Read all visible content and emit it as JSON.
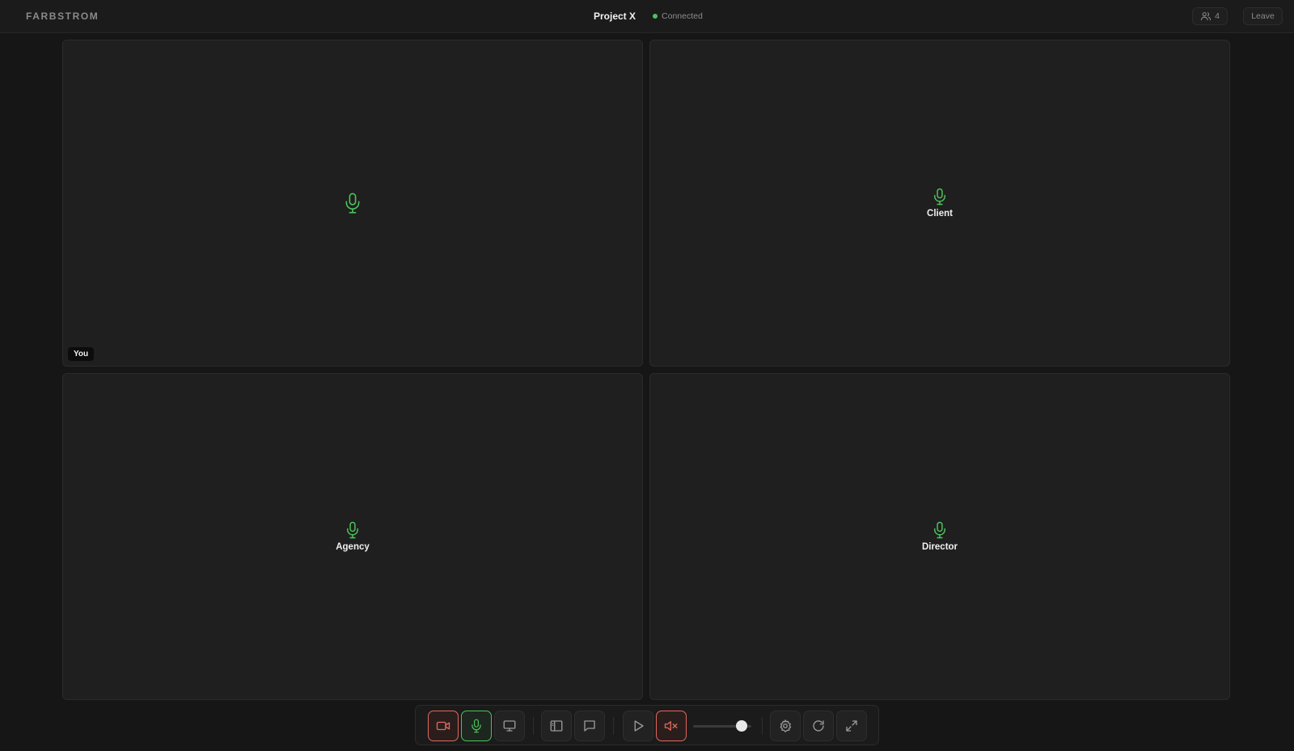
{
  "header": {
    "brand": "FARBSTROM",
    "project_title": "Project X",
    "status_text": "Connected",
    "status_color": "#4cc35a",
    "participant_count": "4",
    "leave_label": "Leave"
  },
  "tiles": [
    {
      "name": "",
      "badge": "You",
      "mic_icon": "microphone-icon"
    },
    {
      "name": "Client",
      "mic_icon": "microphone-icon"
    },
    {
      "name": "Agency",
      "mic_icon": "microphone-icon"
    },
    {
      "name": "Director",
      "mic_icon": "microphone-icon"
    }
  ],
  "toolbar": {
    "buttons": [
      {
        "icon": "video-camera-icon",
        "state": "off"
      },
      {
        "icon": "microphone-icon",
        "state": "on"
      },
      {
        "icon": "screen-share-icon"
      },
      {
        "icon": "sidebar-icon"
      },
      {
        "icon": "chat-icon"
      },
      {
        "icon": "play-icon"
      },
      {
        "icon": "volume-muted-icon",
        "state": "muted"
      },
      {
        "icon": "settings-icon"
      },
      {
        "icon": "refresh-icon"
      },
      {
        "icon": "fullscreen-icon"
      }
    ],
    "volume_level": 0.92
  },
  "colors": {
    "accent_green": "#4cc35a",
    "alert_red": "#e0685c"
  }
}
